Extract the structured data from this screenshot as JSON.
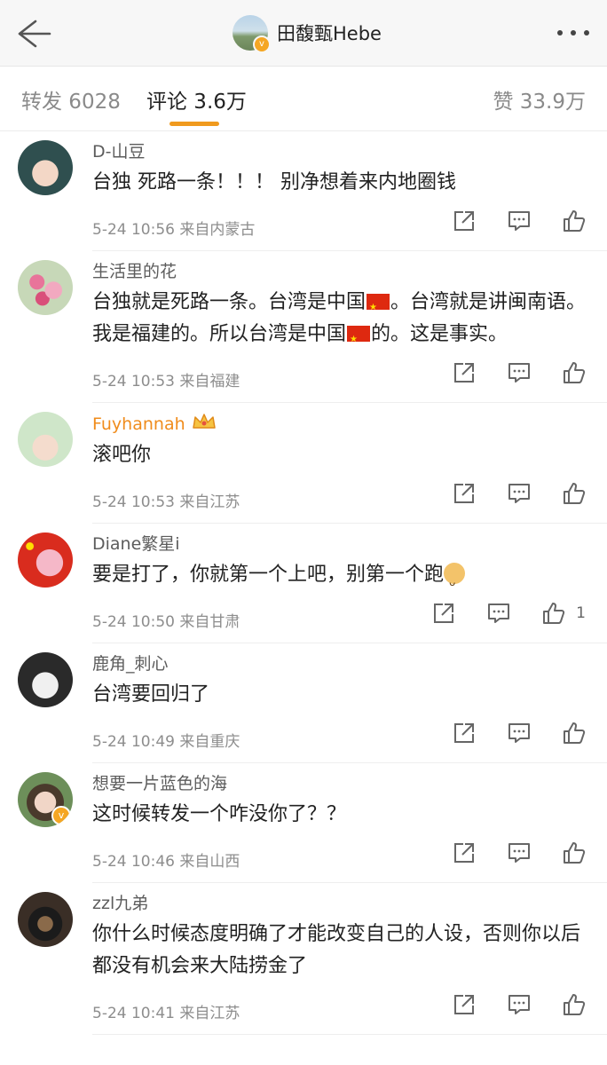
{
  "header": {
    "title": "田馥甄Hebe"
  },
  "tabs": {
    "repost": "转发 6028",
    "comments": "评论 3.6万",
    "likes": "赞 33.9万"
  },
  "comments": [
    {
      "user": "D-山豆",
      "text": "台独 死路一条！！！ 别净想着来内地圈钱",
      "time": "5-24 10:56",
      "location": "来自内蒙古"
    },
    {
      "user": "生活里的花",
      "text_a": "台独就是死路一条。台湾是中国",
      "text_b": "。台湾就是讲闽南语。我是福建的。所以台湾是中国",
      "text_c": "的。这是事实。",
      "time": "5-24 10:53",
      "location": "来自福建"
    },
    {
      "user": "Fuyhannah",
      "text": "滚吧你",
      "time": "5-24 10:53",
      "location": "来自江苏"
    },
    {
      "user": "Diane繁星i",
      "text": "要是打了，你就第一个上吧，别第一个跑",
      "time": "5-24 10:50",
      "location": "来自甘肃",
      "likes": "1"
    },
    {
      "user": "鹿角_刺心",
      "text": "台湾要回归了",
      "time": "5-24 10:49",
      "location": "来自重庆"
    },
    {
      "user": "想要一片蓝色的海",
      "text": "这时候转发一个咋没你了？？",
      "time": "5-24 10:46",
      "location": "来自山西"
    },
    {
      "user": "zzl九弟",
      "text": "你什么时候态度明确了才能改变自己的人设，否则你以后都没有机会来大陆捞金了",
      "time": "5-24 10:41",
      "location": "来自江苏"
    }
  ]
}
